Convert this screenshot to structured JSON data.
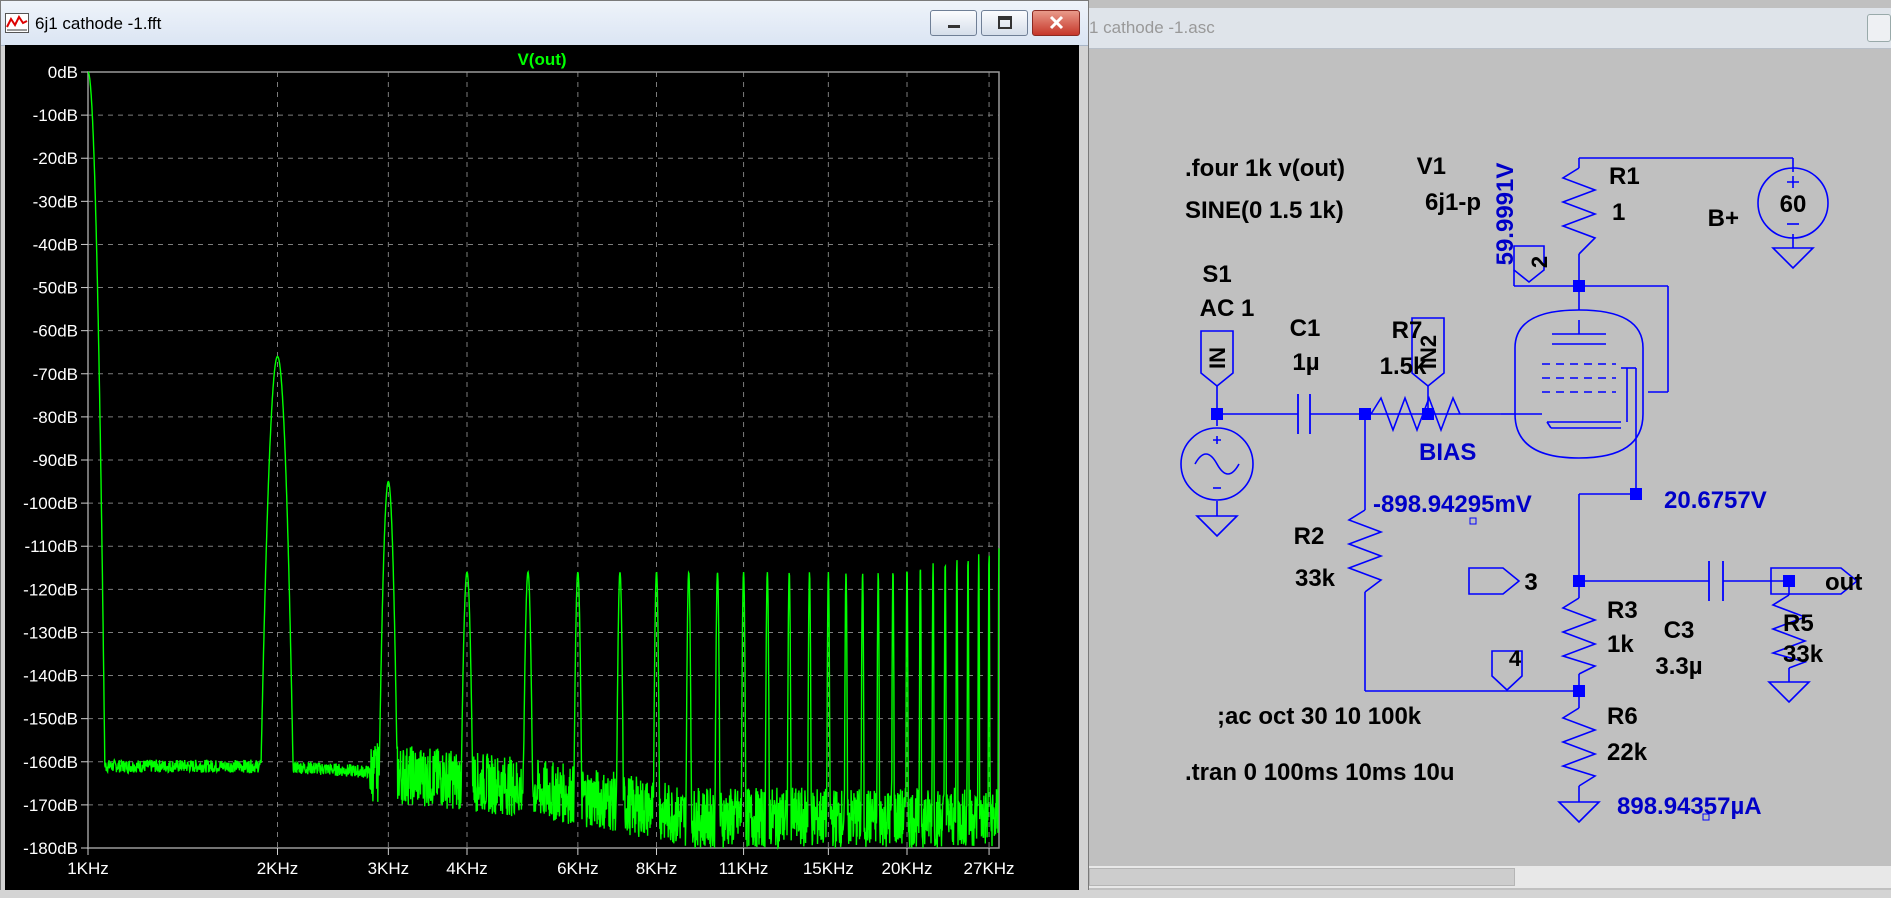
{
  "fft_window": {
    "title": "6j1 cathode -1.fft",
    "trace_label": "V(out)",
    "y_ticks": [
      "0dB",
      "-10dB",
      "-20dB",
      "-30dB",
      "-40dB",
      "-50dB",
      "-60dB",
      "-70dB",
      "-80dB",
      "-90dB",
      "-100dB",
      "-110dB",
      "-120dB",
      "-130dB",
      "-140dB",
      "-150dB",
      "-160dB",
      "-170dB",
      "-180dB"
    ],
    "x_ticks": [
      "1KHz",
      "2KHz",
      "3KHz",
      "4KHz",
      "6KHz",
      "8KHz",
      "11KHz",
      "15KHz",
      "20KHz",
      "27KHz"
    ],
    "colors": {
      "trace": "#00ff00",
      "grid": "#808080",
      "background": "#000000",
      "label": "#00ff00"
    }
  },
  "schematic_window": {
    "title": "1 cathode -1.asc",
    "directives": {
      "four": ".four 1k v(out)",
      "ac": ";ac oct 30 10 100k",
      "tran": ".tran 0 100ms 10ms 10u"
    },
    "components": {
      "s1_name": "S1",
      "s1_value": "AC 1",
      "s1_sine": "SINE(0 1.5 1k)",
      "v1_name": "V1",
      "v1_model": "6j1-p",
      "r1_name": "R1",
      "r1_value": "1",
      "bplus_label": "B+",
      "bplus_value": "60",
      "c1_name": "C1",
      "c1_value": "1µ",
      "r7_name": "R7",
      "r7_value": "1.5k",
      "r2_name": "R2",
      "r2_value": "33k",
      "r3_name": "R3",
      "r3_value": "1k",
      "r5_name": "R5",
      "r5_value": "33k",
      "c3_name": "C3",
      "c3_value": "3.3µ",
      "r6_name": "R6",
      "r6_value": "22k"
    },
    "net_labels": {
      "in": "IN",
      "in2": "IN2",
      "n2": "2",
      "n3": "3",
      "n4": "4",
      "out": "out",
      "bias": "BIAS"
    },
    "probes": {
      "plate_voltage": "59.9991V",
      "grid_voltage": "-898.94295mV",
      "cathode_voltage": "20.6757V",
      "current": "898.94357µA"
    },
    "colors": {
      "wire": "#0000ff",
      "text": "#000000",
      "probe": "#0000c8"
    }
  }
}
